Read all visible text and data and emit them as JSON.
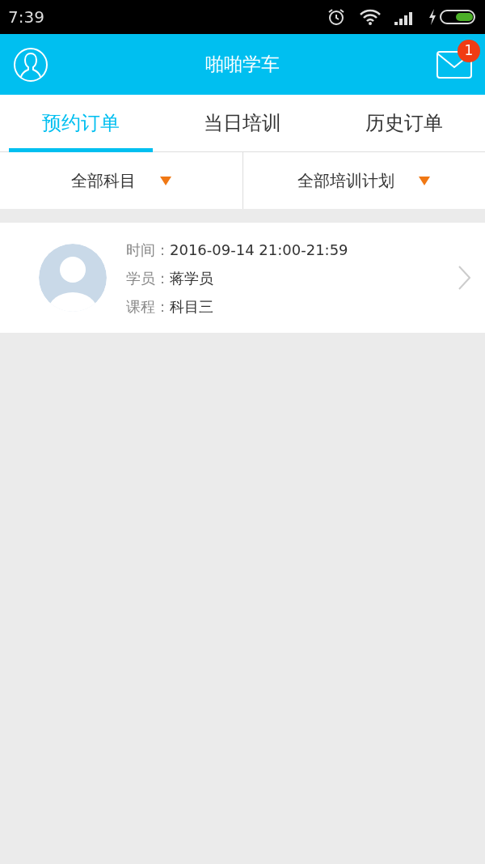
{
  "status_bar": {
    "time": "7:39"
  },
  "header": {
    "title": "啪啪学车",
    "badge": "1"
  },
  "tabs": [
    {
      "label": "预约订单",
      "selected": true
    },
    {
      "label": "当日培训",
      "selected": false
    },
    {
      "label": "历史订单",
      "selected": false
    }
  ],
  "filters": [
    {
      "label": "全部科目"
    },
    {
      "label": "全部培训计划"
    }
  ],
  "orders": [
    {
      "fields": [
        {
          "label": "时间：",
          "value": "2016-09-14 21:00-21:59"
        },
        {
          "label": "学员：",
          "value": "蒋学员"
        },
        {
          "label": "课程：",
          "value": "科目三"
        }
      ]
    }
  ]
}
